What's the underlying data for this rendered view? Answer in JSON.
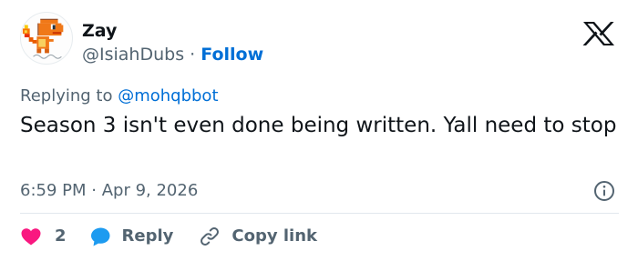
{
  "author": {
    "display_name": "Zay",
    "handle": "@IsiahDubs",
    "separator": " · ",
    "follow_label": "Follow",
    "avatar_icon": "charmander-sprite-avatar"
  },
  "platform": {
    "logo_icon": "x-logo-icon"
  },
  "reply_context": {
    "prefix": "Replying to ",
    "mention": "@mohqbbot"
  },
  "tweet": {
    "text": "Season 3 isn't even done being written. Yall need to stop",
    "time": "6:59 PM",
    "separator": " · ",
    "date": "Apr 9, 2026"
  },
  "actions": {
    "like_count": "2",
    "reply_label": "Reply",
    "copy_link_label": "Copy link"
  },
  "colors": {
    "accent": "#006fd6",
    "like": "#f91880",
    "reply": "#1d9bf0",
    "muted": "#536471",
    "text": "#0f1419"
  }
}
